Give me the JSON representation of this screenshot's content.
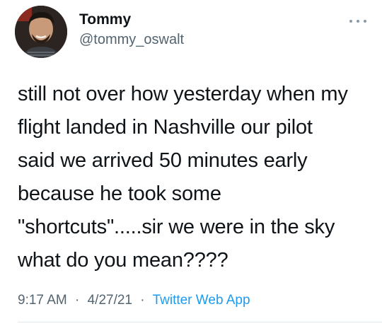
{
  "author": {
    "name": "Tommy",
    "handle": "@tommy_oswalt"
  },
  "tweet": {
    "lines": [
      "still not over how yesterday when my",
      "flight landed in Nashville our pilot",
      "said we arrived 50 minutes early",
      "because he took some",
      "\"shortcuts\".....sir we were in the sky",
      "what do you mean????"
    ]
  },
  "meta": {
    "time": "9:17 AM",
    "separator": "·",
    "date": "4/27/21",
    "source": "Twitter Web App"
  },
  "icons": {
    "more": "more-options-icon"
  },
  "colors": {
    "text": "#0f1419",
    "secondary": "#536471",
    "link": "#1d9bf0"
  }
}
